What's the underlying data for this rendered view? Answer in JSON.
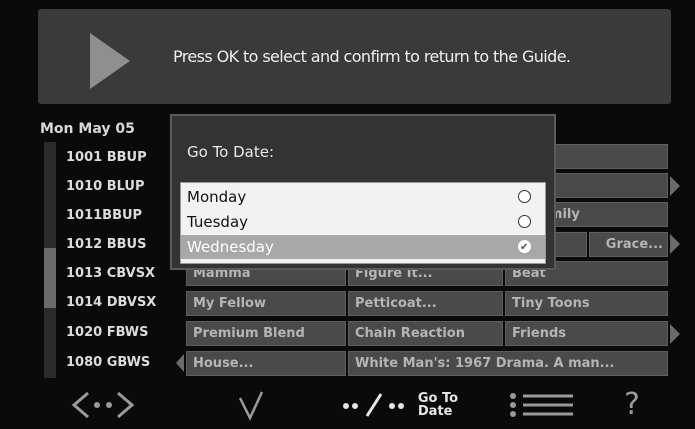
{
  "banner": {
    "message": "Press OK to select and confirm to return to the Guide."
  },
  "guide": {
    "date": "Mon May 05",
    "channels": [
      {
        "label": "1001 BBUP"
      },
      {
        "label": "1010 BLUP"
      },
      {
        "label": "1011BBUP"
      },
      {
        "label": "1012 BBUS"
      },
      {
        "label": "1013 CBVSX"
      },
      {
        "label": "1014 DBVSX"
      },
      {
        "label": "1020 FBWS"
      },
      {
        "label": "1080 GBWS"
      }
    ],
    "programs": {
      "r2_right": "ss Family",
      "r3_right": "Grace...",
      "r4": [
        "Mamma",
        "Figure It...",
        "Beat"
      ],
      "r5": [
        "My Fellow",
        "Petticoat...",
        "Tiny Toons"
      ],
      "r6": [
        "Premium Blend",
        "Chain Reaction",
        "Friends"
      ],
      "r7": [
        "House...",
        "White Man's: 1967 Drama. A man..."
      ]
    }
  },
  "dialog": {
    "title": "Go To Date:",
    "options": [
      {
        "label": "Monday",
        "selected": false
      },
      {
        "label": "Tuesday",
        "selected": false
      },
      {
        "label": "Wednesday",
        "selected": true
      }
    ]
  },
  "bottom_bar": {
    "goto_line1": "Go To",
    "goto_line2": "Date",
    "help": "?"
  }
}
